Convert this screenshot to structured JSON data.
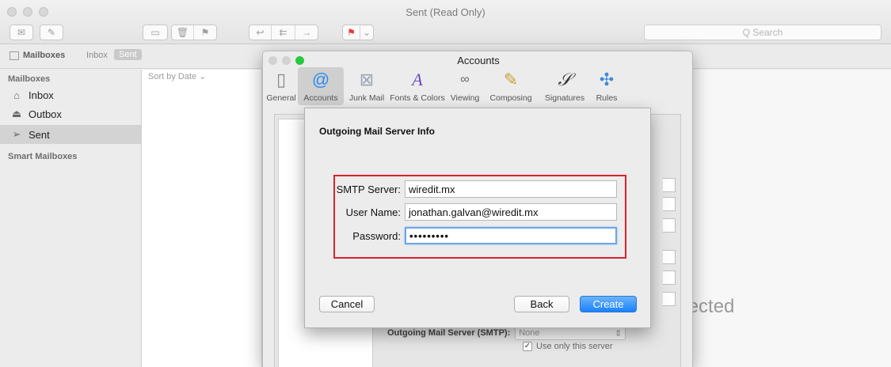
{
  "window": {
    "title": "Sent (Read Only)"
  },
  "search": {
    "placeholder": "Q Search"
  },
  "favorites": {
    "mailboxes_label": "Mailboxes",
    "inbox_label": "Inbox",
    "sent_label": "Sent"
  },
  "sidebar": {
    "header": "Mailboxes",
    "items": [
      {
        "label": "Inbox",
        "icon": "tray-icon"
      },
      {
        "label": "Outbox",
        "icon": "outbox-icon"
      },
      {
        "label": "Sent",
        "icon": "paper-plane-icon",
        "selected": true
      }
    ],
    "smart_header": "Smart Mailboxes"
  },
  "message_list": {
    "sort_label": "Sort by Date ⌄"
  },
  "preview": {
    "no_selection_text": "elected"
  },
  "prefs": {
    "title": "Accounts",
    "tabs": [
      {
        "label": "General",
        "icon": "switch-icon"
      },
      {
        "label": "Accounts",
        "icon": "at-icon",
        "selected": true
      },
      {
        "label": "Junk Mail",
        "icon": "trash-bin-icon"
      },
      {
        "label": "Fonts & Colors",
        "icon": "font-icon"
      },
      {
        "label": "Viewing",
        "icon": "glasses-icon"
      },
      {
        "label": "Composing",
        "icon": "pencil-icon"
      },
      {
        "label": "Signatures",
        "icon": "signature-icon"
      },
      {
        "label": "Rules",
        "icon": "rules-icon"
      }
    ],
    "smtp_label": "Outgoing Mail Server (SMTP):",
    "smtp_value": "None",
    "use_only_label": "Use only this server",
    "use_only_checked": true
  },
  "sheet": {
    "title": "Outgoing Mail Server Info",
    "fields": [
      {
        "label": "SMTP Server:",
        "value": "wiredit.mx"
      },
      {
        "label": "User Name:",
        "value": "jonathan.galvan@wiredit.mx"
      },
      {
        "label": "Password:",
        "value": "•••••••••"
      }
    ],
    "cancel_label": "Cancel",
    "back_label": "Back",
    "create_label": "Create",
    "highlight_color": "#d8232a"
  }
}
